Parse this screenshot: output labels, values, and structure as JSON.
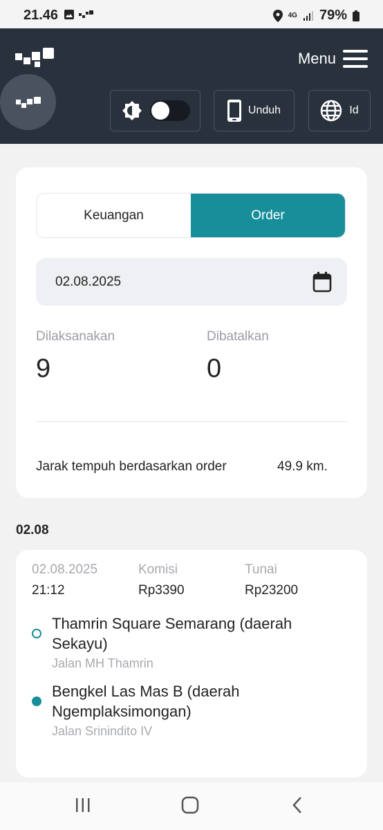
{
  "status_bar": {
    "time": "21.46",
    "network": "4G",
    "battery": "79%"
  },
  "header": {
    "menu_label": "Menu",
    "download_label": "Unduh",
    "language_label": "Id",
    "theme_toggle_on": false
  },
  "tabs": [
    {
      "label": "Keuangan",
      "active": false
    },
    {
      "label": "Order",
      "active": true
    }
  ],
  "date_filter": {
    "value": "02.08.2025"
  },
  "stats": {
    "completed_label": "Dilaksanakan",
    "completed_value": "9",
    "cancelled_label": "Dibatalkan",
    "cancelled_value": "0"
  },
  "distance": {
    "label": "Jarak tempuh berdasarkan order",
    "value": "49.9 km."
  },
  "orders": {
    "group_date": "02.08",
    "items": [
      {
        "date": "02.08.2025",
        "time": "21:12",
        "commission_label": "Komisi",
        "commission_value": "Rp3390",
        "cash_label": "Tunai",
        "cash_value": "Rp23200",
        "pickup_title": "Thamrin Square Semarang (daerah Sekayu)",
        "pickup_street": "Jalan MH Thamrin",
        "dropoff_title": "Bengkel Las Mas B (daerah Ngemplaksimongan)",
        "dropoff_street": "Jalan Srinindito IV"
      }
    ]
  },
  "colors": {
    "header_bg": "#29313d",
    "accent": "#178e99",
    "page_bg": "#f2f2f3"
  }
}
